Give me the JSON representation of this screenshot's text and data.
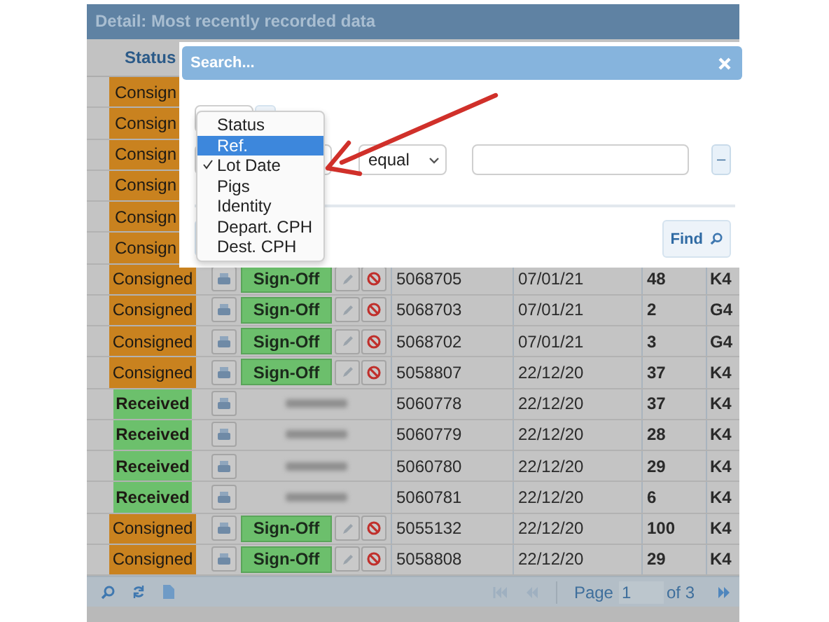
{
  "panel": {
    "title": "Detail: Most recently recorded data"
  },
  "table": {
    "columns": [
      "Status"
    ],
    "rows": [
      {
        "kind": "covered",
        "status": "Consign"
      },
      {
        "kind": "covered",
        "status": "Consign"
      },
      {
        "kind": "covered",
        "status": "Consign"
      },
      {
        "kind": "covered",
        "status": "Consign"
      },
      {
        "kind": "covered",
        "status": "Consign"
      },
      {
        "kind": "covered",
        "status": "Consign"
      },
      {
        "kind": "consigned",
        "status": "Consigned",
        "action": "Sign-Off",
        "ref": "5068705",
        "date": "07/01/21",
        "pigs": "48",
        "column_7": "K4"
      },
      {
        "kind": "consigned",
        "status": "Consigned",
        "action": "Sign-Off",
        "ref": "5068703",
        "date": "07/01/21",
        "pigs": "2",
        "column_7": "G4"
      },
      {
        "kind": "consigned",
        "status": "Consigned",
        "action": "Sign-Off",
        "ref": "5068702",
        "date": "07/01/21",
        "pigs": "3",
        "column_7": "G4"
      },
      {
        "kind": "consigned",
        "status": "Consigned",
        "action": "Sign-Off",
        "ref": "5058807",
        "date": "22/12/20",
        "pigs": "37",
        "column_7": "K4"
      },
      {
        "kind": "received",
        "status": "Received",
        "ref": "5060778",
        "date": "22/12/20",
        "pigs": "37",
        "column_7": "K4"
      },
      {
        "kind": "received",
        "status": "Received",
        "ref": "5060779",
        "date": "22/12/20",
        "pigs": "28",
        "column_7": "K4"
      },
      {
        "kind": "received",
        "status": "Received",
        "ref": "5060780",
        "date": "22/12/20",
        "pigs": "29",
        "column_7": "K4"
      },
      {
        "kind": "received",
        "status": "Received",
        "ref": "5060781",
        "date": "22/12/20",
        "pigs": "6",
        "column_7": "K4"
      },
      {
        "kind": "consigned",
        "status": "Consigned",
        "action": "Sign-Off",
        "ref": "5055132",
        "date": "22/12/20",
        "pigs": "100",
        "column_7": "K4"
      },
      {
        "kind": "consigned",
        "status": "Consigned",
        "action": "Sign-Off",
        "ref": "5058808",
        "date": "22/12/20",
        "pigs": "29",
        "column_7": "K4"
      }
    ]
  },
  "pager": {
    "page_label": "Page",
    "page": "1",
    "page_count": "of 3"
  },
  "dialog": {
    "title": "Search...",
    "operator": "equal",
    "remove_label": "–",
    "find_label": "Find",
    "menu": [
      {
        "label": "Status",
        "selected": false,
        "highlighted": false
      },
      {
        "label": "Ref.",
        "selected": false,
        "highlighted": true
      },
      {
        "label": "Lot Date",
        "selected": true,
        "highlighted": false
      },
      {
        "label": "Pigs",
        "selected": false,
        "highlighted": false
      },
      {
        "label": "Identity",
        "selected": false,
        "highlighted": false
      },
      {
        "label": "Depart. CPH",
        "selected": false,
        "highlighted": false
      },
      {
        "label": "Dest. CPH",
        "selected": false,
        "highlighted": false
      }
    ]
  }
}
